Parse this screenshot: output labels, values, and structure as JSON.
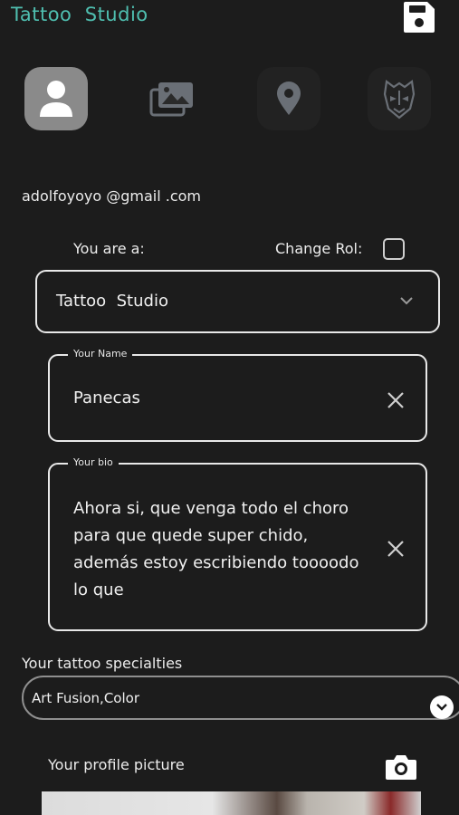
{
  "app": {
    "title": "Tattoo  Studio"
  },
  "header": {
    "save_icon": "save-icon"
  },
  "tabs": [
    {
      "icon": "profile-icon",
      "active": true
    },
    {
      "icon": "gallery-icon",
      "active": false
    },
    {
      "icon": "location-icon",
      "active": false
    },
    {
      "icon": "tattoo-mask-icon",
      "active": false
    }
  ],
  "profile": {
    "email": "adolfoyoyo @gmail .com",
    "role_label": "You are a:",
    "change_rol_label": "Change Rol:",
    "change_rol_checked": false,
    "role_select": {
      "value": "Tattoo  Studio"
    },
    "name_field": {
      "legend": "Your Name",
      "value": "Panecas"
    },
    "bio_field": {
      "legend": "Your bio",
      "value": "Ahora si, que venga todo el choro para que quede super chido, además estoy escribiendo toooodo lo que"
    },
    "specialties": {
      "label": "Your tattoo specialties",
      "value": "Art Fusion,Color"
    },
    "picture": {
      "label": "Your profile picture"
    }
  },
  "colors": {
    "accent": "#4fbfb0",
    "background": "#1c1c1c",
    "tab_active": "#8a8a8a"
  }
}
